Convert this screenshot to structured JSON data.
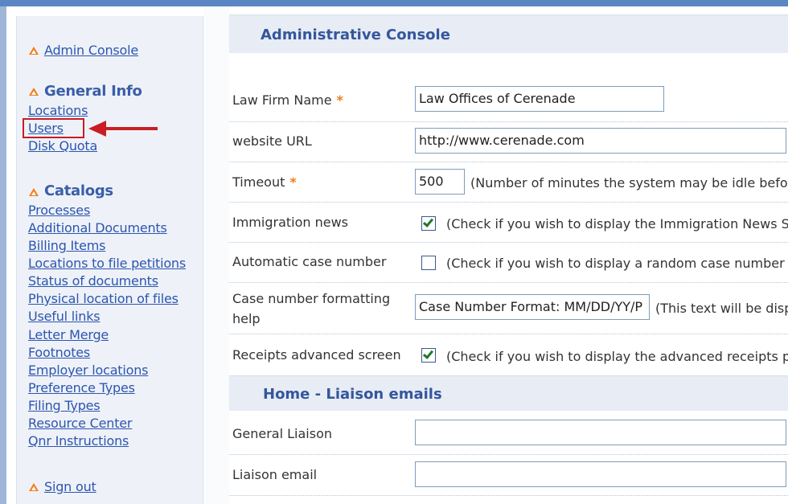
{
  "sidebar": {
    "admin_console": "Admin Console",
    "general_info": {
      "heading": "General Info",
      "items": [
        "Locations",
        "Users",
        "Disk Quota"
      ]
    },
    "catalogs": {
      "heading": "Catalogs",
      "items": [
        "Processes",
        "Additional Documents",
        "Billing Items",
        "Locations to file petitions",
        "Status of documents",
        "Physical location of files",
        "Useful links",
        "Letter Merge",
        "Footnotes",
        "Employer locations",
        "Preference Types",
        "Filing Types",
        "Resource Center",
        "Qnr Instructions"
      ]
    },
    "sign_out": "Sign out"
  },
  "main": {
    "section_title": "Administrative Console",
    "fields": {
      "law_firm_name": {
        "label": "Law Firm Name",
        "value": "Law Offices of Cerenade"
      },
      "website_url": {
        "label": "website URL",
        "value": "http://www.cerenade.com"
      },
      "timeout": {
        "label": "Timeout",
        "value": "500",
        "help": "(Number of minutes the system may be idle befor"
      },
      "immigration_news": {
        "label": "Immigration news",
        "help": "(Check if you wish to display the Immigration News S"
      },
      "auto_case_number": {
        "label": "Automatic case number",
        "help": "(Check if you wish to display a random case number"
      },
      "case_format_help": {
        "label_line1": "Case number formatting",
        "label_line2": "help",
        "value": "Case Number Format: MM/DD/YY/P",
        "help": "(This text will be disp"
      },
      "receipts_advanced": {
        "label": "Receipts advanced screen",
        "help": "(Check if you wish to display the advanced receipts p"
      }
    },
    "liaison_section_title": "Home - Liaison emails",
    "liaison": {
      "general_liaison": {
        "label": "General Liaison",
        "value": ""
      },
      "liaison_email": {
        "label": "Liaison email",
        "value": ""
      }
    },
    "required_marker": "*"
  }
}
